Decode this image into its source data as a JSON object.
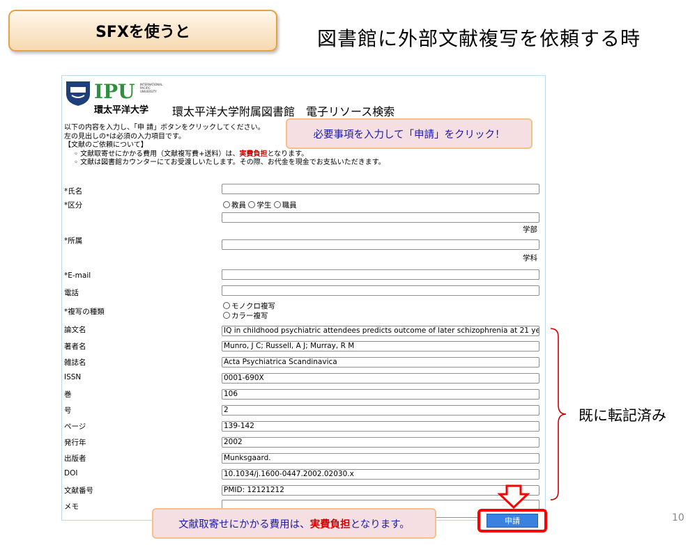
{
  "slide": {
    "badge": "SFXを使うと",
    "title": "図書館に外部文献複写を依頼する時",
    "page_number": "10"
  },
  "header": {
    "logo_text": "IPU",
    "logo_sub": [
      "INTERNATIONAL",
      "PACIFIC",
      "UNIVERSITY"
    ],
    "logo_jp": "環太平洋大学",
    "library_title": "環太平洋大学附属図書館　電子リソース検索"
  },
  "intro": {
    "line1": "以下の内容を入力し、「申 請」ボタンをクリックしてください。",
    "line2": "左の見出しの*は必須の入力項目です。",
    "line3": "【文献のご依頼について】",
    "bullet1_pre": "◦ 文献取寄せにかかる費用（文献複写費+送料）は、",
    "bullet1_red": "実費負担",
    "bullet1_post": "となります。",
    "bullet2": "◦ 文献は図書館カウンターにてお受渡しいたします。その際、お代金を現金でお支払いただきます。"
  },
  "form": {
    "name_label": "*氏名",
    "name_value": "",
    "category_label": "*区分",
    "category_options": [
      "教員",
      "学生",
      "職員"
    ],
    "faculty_value": "",
    "faculty_suffix": "学部",
    "affiliation_label": "*所属",
    "department_value": "",
    "department_suffix": "学科",
    "email_label": "*E-mail",
    "email_value": "",
    "phone_label": "電話",
    "phone_value": "",
    "copy_type_label": "*複写の種類",
    "copy_type_options": [
      "モノクロ複写",
      "カラー複写"
    ],
    "article_title_label": "論文名",
    "article_title_value": "IQ in childhood psychiatric attendees predicts outcome of later schizophrenia at 21 ye",
    "authors_label": "著者名",
    "authors_value": "Munro, J C; Russell, A J; Murray, R M",
    "journal_label": "雑誌名",
    "journal_value": "Acta Psychiatrica Scandinavica",
    "issn_label": "ISSN",
    "issn_value": "0001-690X",
    "volume_label": "巻",
    "volume_value": "106",
    "issue_label": "号",
    "issue_value": "2",
    "pages_label": "ページ",
    "pages_value": "139-142",
    "year_label": "発行年",
    "year_value": "2002",
    "publisher_label": "出版者",
    "publisher_value": "Munksgaard.",
    "doi_label": "DOI",
    "doi_value": "10.1034/j.1600-0447.2002.02030.x",
    "docid_label": "文献番号",
    "docid_value": "PMID: 12121212",
    "memo_label": "メモ",
    "memo_value": "",
    "submit_label": "申請"
  },
  "callouts": {
    "top": "必要事項を入力して「申請」をクリック！",
    "bottom_pre": "文献取寄せにかかる費用は、",
    "bottom_red": "実費負担",
    "bottom_post": "となります。",
    "brace_label": "既に転記済み"
  },
  "colors": {
    "badge_border": "#e6a24a",
    "logo_green": "#2f8f3f",
    "emphasis_red": "#d10000",
    "callout_text": "#1a1aaa",
    "callout_bg": "#f5dfe3",
    "callout_border": "#f3c08a",
    "submit_blue": "#3b82e0",
    "highlight_red": "#ff0000"
  }
}
